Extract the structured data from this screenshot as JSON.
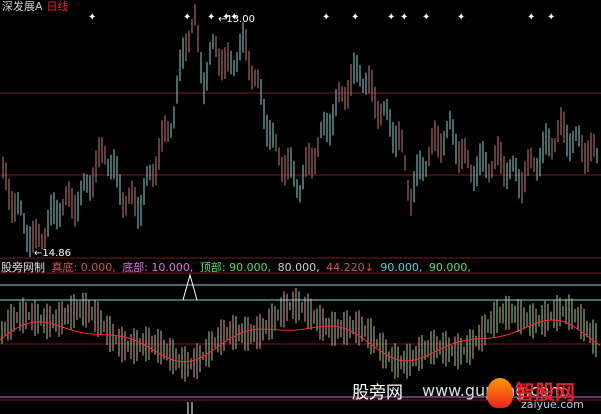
{
  "header": {
    "title": "深发展A",
    "period": "日线"
  },
  "price_panel": {
    "high_label": "←13.00",
    "low_label": "←14.86"
  },
  "indicator": {
    "name": "股旁网制",
    "items": [
      {
        "key": "true_bottom",
        "text": "真底: 0.000,",
        "color": "#e0e0e0",
        "label_color": "#d35454"
      },
      {
        "key": "bottom",
        "text": "底部: 10.000,",
        "color": "#e070e0"
      },
      {
        "key": "top",
        "text": "顶部: 90.000,",
        "color": "#50e050"
      },
      {
        "key": "v80",
        "text": "80.000,",
        "color": "#d0d0d0"
      },
      {
        "key": "current",
        "text": "44.220↓",
        "color": "#e05050"
      },
      {
        "key": "v90a",
        "text": "90.000,",
        "color": "#50d0e0"
      },
      {
        "key": "v90b",
        "text": "90.000,",
        "color": "#50e070"
      }
    ]
  },
  "watermark": {
    "cn": "股旁网",
    "url": "www.gupang.com",
    "logo_name": "智股网",
    "logo_url": "zaiyue.com"
  },
  "colors": {
    "up": "#c77a7a",
    "down": "#84d4d4",
    "grid": "#7a1c1c",
    "ma": "#ff2a2a",
    "cyan_line": "#80d8d8",
    "magenta_line": "#d070d0",
    "green_bar": "#9ad884",
    "pink_bar": "#e0a0a0"
  }
}
